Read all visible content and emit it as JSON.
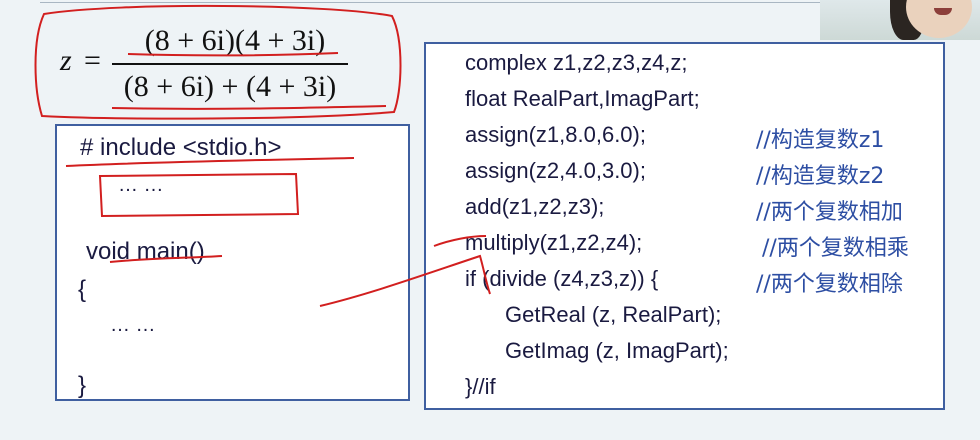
{
  "formula": {
    "lhs": "z",
    "equals": "=",
    "numerator": "(8 + 6i)(4 + 3i)",
    "denominator": "(8 + 6i) + (4 + 3i)"
  },
  "left_code": {
    "include": "# include <stdio.h>",
    "ellipsis_1": "… …",
    "main_sig": "void main()",
    "open_brace": "{",
    "ellipsis_2": "… …",
    "close_brace": "}"
  },
  "right_code": {
    "lines": [
      "complex z1,z2,z3,z4,z;",
      "float RealPart,ImagPart;",
      "assign(z1,8.0,6.0);",
      "assign(z2,4.0,3.0);",
      "add(z1,z2,z3);",
      "multiply(z1,z2,z4);",
      "if (divide (z4,z3,z))   {",
      "GetReal (z, RealPart);",
      "GetImag (z, ImagPart);",
      "}//if"
    ],
    "comments": [
      "//构造复数z1",
      "//构造复数z2",
      "//两个复数相加",
      "//两个复数相乘",
      "//两个复数相除"
    ]
  },
  "colors": {
    "background": "#eef3f6",
    "box_border": "#3f5fa0",
    "code_text": "#1a1a40",
    "comment_text": "#2d4ea3",
    "annotation_red": "#d21f1f"
  }
}
